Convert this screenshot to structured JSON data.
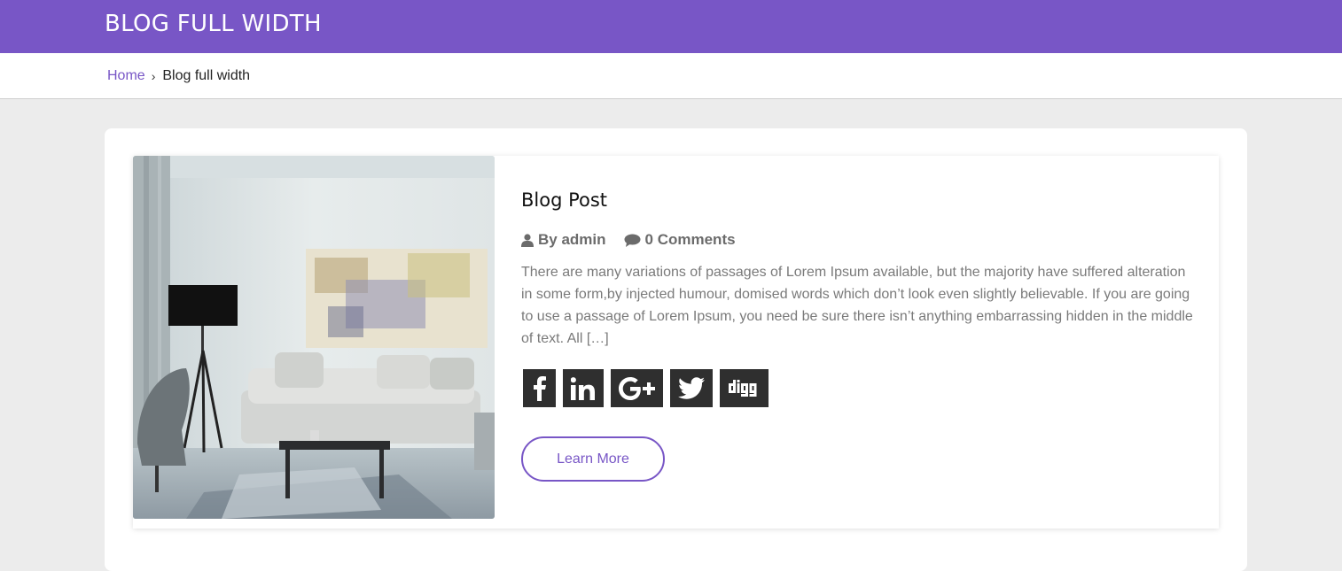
{
  "header": {
    "title": "BLOG FULL WIDTH",
    "bg_color": "#7856c6"
  },
  "breadcrumb": {
    "home": "Home",
    "separator": "›",
    "current": "Blog full width"
  },
  "post": {
    "title": "Blog Post",
    "author": "By admin",
    "comments": "0 Comments",
    "excerpt": "There are many variations of passages of Lorem Ipsum available, but the majority have suffered alteration in some form,by injected humour, domised words which don’t look even slightly believable. If you are going to use a passage of Lorem Ipsum, you need be sure there isn’t anything embarrassing hidden in the middle of text. All […]",
    "image_icon": "living-room-photo",
    "learn_more": "Learn More",
    "social": [
      {
        "name": "facebook",
        "glyph": "f"
      },
      {
        "name": "linkedin",
        "glyph": "in"
      },
      {
        "name": "google-plus",
        "glyph": "G+"
      },
      {
        "name": "twitter",
        "glyph": "bird"
      },
      {
        "name": "digg",
        "glyph": "digg"
      }
    ]
  }
}
